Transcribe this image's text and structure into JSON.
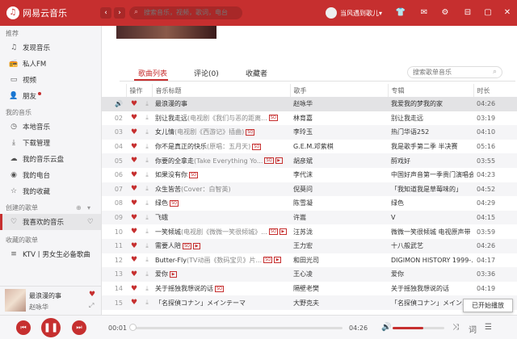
{
  "app": {
    "logo_char": "♫",
    "name": "网易云音乐"
  },
  "topbar": {
    "back": "‹",
    "forward": "›",
    "search_placeholder": "搜索音乐，视频，歌词，电台",
    "user_name": "当风遇到歌儿",
    "user_dropdown": "▾",
    "icons": [
      "shirt-icon",
      "mail-icon",
      "gear-icon",
      "minimize-icon",
      "maximize-icon",
      "close-icon"
    ]
  },
  "sidebar": {
    "recommend_title": "推荐",
    "recommend": [
      {
        "label": "发现音乐",
        "icon": "♫"
      },
      {
        "label": "私人FM",
        "icon": "📻"
      },
      {
        "label": "视频",
        "icon": "▭"
      },
      {
        "label": "朋友",
        "icon": "👤"
      }
    ],
    "mymusic_title": "我的音乐",
    "mymusic": [
      {
        "label": "本地音乐",
        "icon": "◷"
      },
      {
        "label": "下载管理",
        "icon": "⤓"
      },
      {
        "label": "我的音乐云盘",
        "icon": "☁"
      },
      {
        "label": "我的电台",
        "icon": "◉"
      },
      {
        "label": "我的收藏",
        "icon": "☆"
      }
    ],
    "created_title": "创建的歌单",
    "created": [
      {
        "label": "我喜欢的音乐",
        "icon": "♡"
      }
    ],
    "fav_title": "收藏的歌单",
    "fav": [
      {
        "label": "KTV丨男女生必备歌曲",
        "icon": "≡"
      }
    ]
  },
  "now_playing": {
    "title": "最浪漫的事",
    "artist": "赵咏华"
  },
  "tabs": [
    {
      "label": "歌曲列表",
      "active": true
    },
    {
      "label": "评论(0)",
      "active": false
    },
    {
      "label": "收藏者",
      "active": false
    }
  ],
  "playlist_search_placeholder": "搜索歌单音乐",
  "columns": {
    "ops": "操作",
    "title": "音乐标题",
    "artist": "歌手",
    "album": "专辑",
    "duration": "时长"
  },
  "songs": [
    {
      "num": "",
      "title": "最浪漫的事",
      "sub": "",
      "sq": false,
      "mv": false,
      "artist": "赵咏华",
      "album": "我爱我的梦我的家",
      "duration": "04:26",
      "playing": true
    },
    {
      "num": "02",
      "title": "别让我走远",
      "sub": "(电视剧《我们与恶的距离...",
      "sq": true,
      "mv": false,
      "artist": "林育嘉",
      "album": "别让我走远",
      "duration": "03:19"
    },
    {
      "num": "03",
      "title": "女儿情",
      "sub": "(电视剧《西游记》插曲)",
      "sq": true,
      "mv": false,
      "artist": "李玲玉",
      "album": "热门华语252",
      "duration": "04:10"
    },
    {
      "num": "04",
      "title": "你不是真正的快乐",
      "sub": "(原唱：五月天)",
      "sq": true,
      "mv": false,
      "artist": "G.E.M.邓紫棋",
      "album": "我是歌手第二季 半决赛",
      "duration": "05:16"
    },
    {
      "num": "05",
      "title": "你要的全拿走",
      "sub": "(Take Everything Yo...",
      "sq": true,
      "mv": true,
      "artist": "胡彦斌",
      "album": "酹戏好",
      "duration": "03:55"
    },
    {
      "num": "06",
      "title": "如果没有你",
      "sub": "",
      "sq": true,
      "mv": false,
      "artist": "李代沫",
      "album": "中国好声音第一季贵门演唱会",
      "duration": "04:23"
    },
    {
      "num": "07",
      "title": "众生皆苦",
      "sub": "(Cover：白智英)",
      "sq": false,
      "mv": false,
      "artist": "倪莫问",
      "album": "「我知道我是草莓味的」",
      "duration": "04:52"
    },
    {
      "num": "08",
      "title": "绿色",
      "sub": "",
      "sq": true,
      "mv": false,
      "artist": "陈雪凝",
      "album": "绿色",
      "duration": "04:29"
    },
    {
      "num": "09",
      "title": "飞蛾",
      "sub": "",
      "sq": false,
      "mv": false,
      "artist": "许嵩",
      "album": "V",
      "duration": "04:15"
    },
    {
      "num": "10",
      "title": "一笑倾城",
      "sub": "(电视剧《微微一笑很倾城》...",
      "sq": true,
      "mv": true,
      "artist": "汪苏泷",
      "album": "微微一笑很倾城 电视原声带",
      "duration": "03:59"
    },
    {
      "num": "11",
      "title": "需要人陪",
      "sub": "",
      "sq": true,
      "mv": true,
      "artist": "王力宏",
      "album": "十八般武艺",
      "duration": "04:26"
    },
    {
      "num": "12",
      "title": "Butter-Fly",
      "sub": "(TV动画《数码宝贝》片...",
      "sq": true,
      "mv": true,
      "artist": "和田光司",
      "album": "DIGIMON HISTORY 1999-...",
      "duration": "04:17"
    },
    {
      "num": "13",
      "title": "爱你",
      "sub": "",
      "sq": false,
      "mv": true,
      "artist": "王心凌",
      "album": "爱你",
      "duration": "03:36"
    },
    {
      "num": "14",
      "title": "关于摇独我想说的话",
      "sub": "",
      "sq": true,
      "mv": false,
      "artist": "隔壁老樊",
      "album": "关于摇独我想说的话",
      "duration": "04:19"
    },
    {
      "num": "15",
      "title": "「名探偵コナン」メインテーマ",
      "sub": "",
      "sq": false,
      "mv": false,
      "artist": "大野克夫",
      "album": "「名探偵コナン」メイン...",
      "duration": "02:11"
    }
  ],
  "player": {
    "elapsed": "00:01",
    "total": "04:26",
    "progress": 0.01,
    "volume": 0.6
  },
  "tooltip": "已开始播放"
}
